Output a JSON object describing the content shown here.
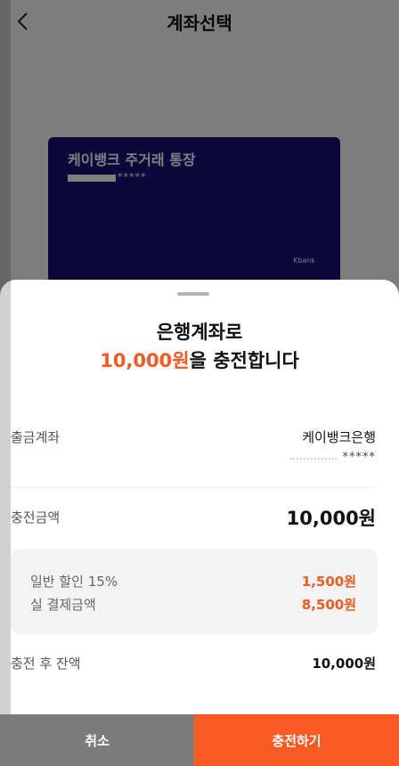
{
  "background": {
    "title": "계좌선택",
    "card": {
      "name": "케이뱅크 주거래 통장",
      "number_masked": "*****",
      "brand": "Kbank"
    }
  },
  "sheet": {
    "title_line1": "은행계좌로",
    "title_amount": "10,000원",
    "title_suffix": "을 충전합니다",
    "withdraw_label": "출금계좌",
    "withdraw_bank": "케이뱅크은행",
    "withdraw_account_masked": "*****",
    "charge_label": "충전금액",
    "charge_value": "10,000원",
    "discount": {
      "label": "일반 할인 15%",
      "value": "1,500원",
      "final_label": "실 결제금액",
      "final_value": "8,500원"
    },
    "after_label": "충전 후 잔액",
    "after_value": "10,000원"
  },
  "buttons": {
    "cancel": "취소",
    "confirm": "충전하기"
  },
  "colors": {
    "accent": "#f25a1e",
    "confirm_button": "#f85a22",
    "cancel_button": "#7b7b7b",
    "card": "#1b1078"
  }
}
